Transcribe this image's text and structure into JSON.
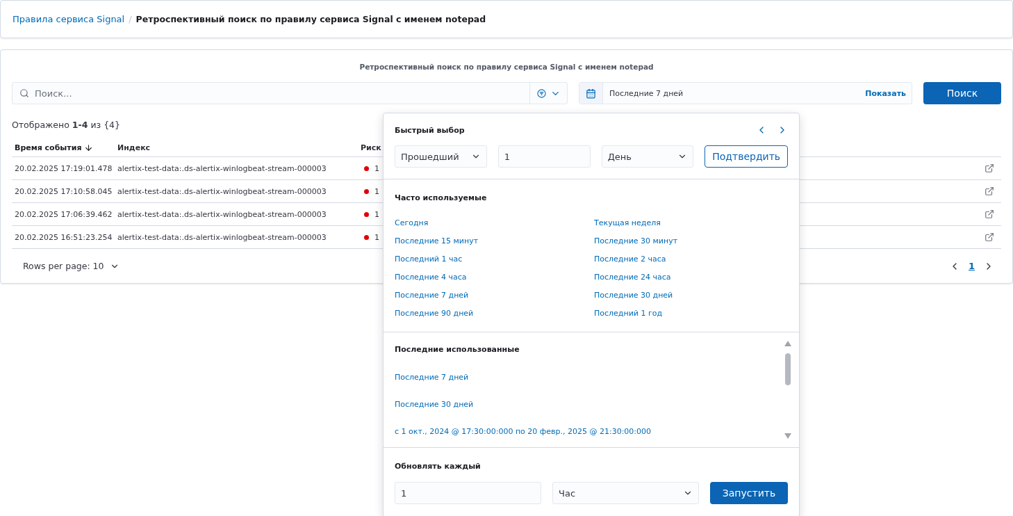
{
  "breadcrumbs": [
    {
      "label": "Правила сервиса Signal",
      "kind": "link"
    },
    {
      "label": "Ретроспективный поиск по правилу сервиса Signal с именем notepad",
      "kind": "current"
    }
  ],
  "breadcrumb_separator": "/",
  "panel_title": "Ретроспективный поиск по правилу сервиса Signal с именем notepad",
  "search": {
    "placeholder": "Поиск..."
  },
  "date_picker": {
    "value": "Последние 7 дней",
    "show_label": "Показать"
  },
  "search_button": "Поиск",
  "summary": "Отображено **1-4** из {4}",
  "table": {
    "columns": [
      {
        "label": "Время события",
        "sorted": true
      },
      {
        "label": "Индекс",
        "sorted": false
      },
      {
        "label": "Риск",
        "sorted": false
      }
    ],
    "rows": [
      {
        "time": "20.02.2025 17:19:01.478",
        "index": "alertix-test-data:.ds-alertix-winlogbeat-stream-000003",
        "risk": "1",
        "color": "#e00000"
      },
      {
        "time": "20.02.2025 17:10:58.045",
        "index": "alertix-test-data:.ds-alertix-winlogbeat-stream-000003",
        "risk": "1",
        "color": "#e00000"
      },
      {
        "time": "20.02.2025 17:06:39.462",
        "index": "alertix-test-data:.ds-alertix-winlogbeat-stream-000003",
        "risk": "1",
        "color": "#e00000"
      },
      {
        "time": "20.02.2025 16:51:23.254",
        "index": "alertix-test-data:.ds-alertix-winlogbeat-stream-000003",
        "risk": "1",
        "color": "#e00000"
      }
    ]
  },
  "pagination": {
    "rows_per_page": "Rows per page: 10",
    "pages": [
      {
        "label": "1",
        "selected": true
      }
    ]
  },
  "popover": {
    "quick_select": {
      "title": "Быстрый выбор",
      "tense": "Прошедший",
      "count": "1",
      "unit": "День",
      "apply": "Подтвердить"
    },
    "common": {
      "title": "Часто используемые",
      "items": [
        "Сегодня",
        "Последние 15 минут",
        "Последний 1 час",
        "Последние 4 часа",
        "Последние 7 дней",
        "Последние 90 дней",
        "Текущая неделя",
        "Последние 30 минут",
        "Последние 2 часа",
        "Последние 24 часа",
        "Последние 30 дней",
        "Последний 1 год"
      ]
    },
    "recent": {
      "title": "Последние использованные",
      "items": [
        "Последние 7 дней",
        "Последние 30 дней",
        "с 1 окт., 2024 @ 17:30:00:000 по 20 февр., 2025 @ 21:30:00:000"
      ]
    },
    "refresh": {
      "title": "Обновлять каждый",
      "value": "1",
      "unit": "Час",
      "start": "Запустить"
    }
  }
}
